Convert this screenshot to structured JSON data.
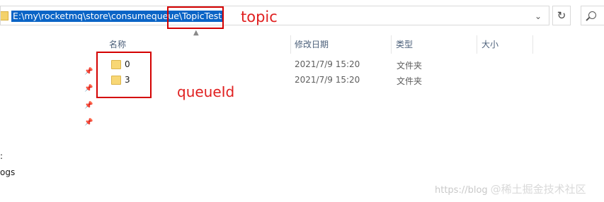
{
  "address_bar": {
    "path": "E:\\my\\rocketmq\\store\\consumequeue\\TopicTest",
    "refresh_icon": "refresh-icon",
    "search_icon": "search-icon"
  },
  "annotations": {
    "topic_label": "topic",
    "queue_label": "queueId",
    "color": "#e02020"
  },
  "columns": {
    "name": "名称",
    "date_modified": "修改日期",
    "type": "类型",
    "size": "大小"
  },
  "files": [
    {
      "name": "0",
      "date": "2021/7/9 15:20",
      "type": "文件夹"
    },
    {
      "name": "3",
      "date": "2021/7/9 15:20",
      "type": "文件夹"
    }
  ],
  "nav_pane": {
    "items": [
      ":",
      "ogs"
    ]
  },
  "watermark": {
    "url": "https://blog",
    "brand": "@稀土掘金技术社区"
  }
}
